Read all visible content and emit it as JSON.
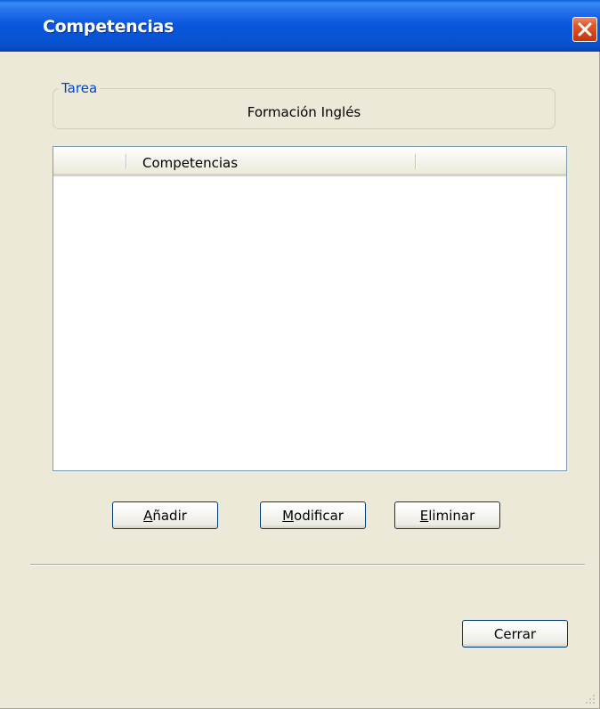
{
  "window": {
    "title": "Competencias",
    "close_icon": "close-icon"
  },
  "group": {
    "legend": "Tarea",
    "value": "Formación Inglés"
  },
  "list": {
    "columns": [
      "",
      "Competencias",
      ""
    ],
    "rows": []
  },
  "buttons": {
    "add": {
      "mnemonic": "A",
      "rest": "ñadir"
    },
    "modify": {
      "mnemonic": "M",
      "rest": "odificar"
    },
    "delete": {
      "mnemonic": "E",
      "rest": "liminar"
    },
    "close": "Cerrar"
  },
  "colors": {
    "title_bar": "#0a58de",
    "dialog_bg": "#ece9d8",
    "legend_text": "#0046d5",
    "close_button": "#d2431a"
  }
}
